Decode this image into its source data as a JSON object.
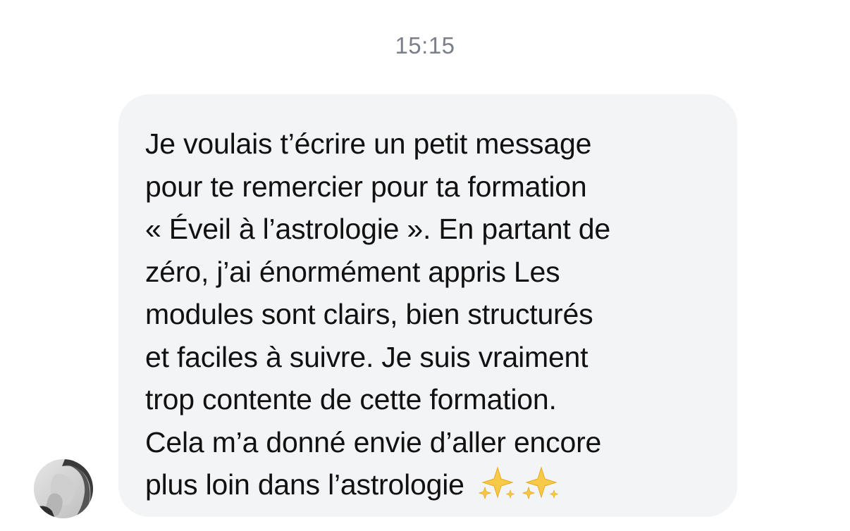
{
  "conversation": {
    "timestamp": "15:15",
    "message": {
      "text": "Je voulais t’écrire un petit message\npour te remercier pour ta formation\n« Éveil à l’astrologie ». En partant de\nzéro, j’ai énormément appris  Les\nmodules sont clairs, bien structurés\net faciles à suivre. Je suis vraiment\ntrop contente de cette formation.\nCela m’a donné envie d’aller encore\nplus loin dans l’astrologie",
      "emojis": [
        "sparkles-icon",
        "sparkles-icon"
      ]
    },
    "sender": {
      "avatar_icon": "avatar"
    }
  },
  "colors": {
    "bubble_background": "#f3f4f6",
    "timestamp_text": "#7a7f8a",
    "message_text": "#111111",
    "sparkle": "#f7c948"
  }
}
